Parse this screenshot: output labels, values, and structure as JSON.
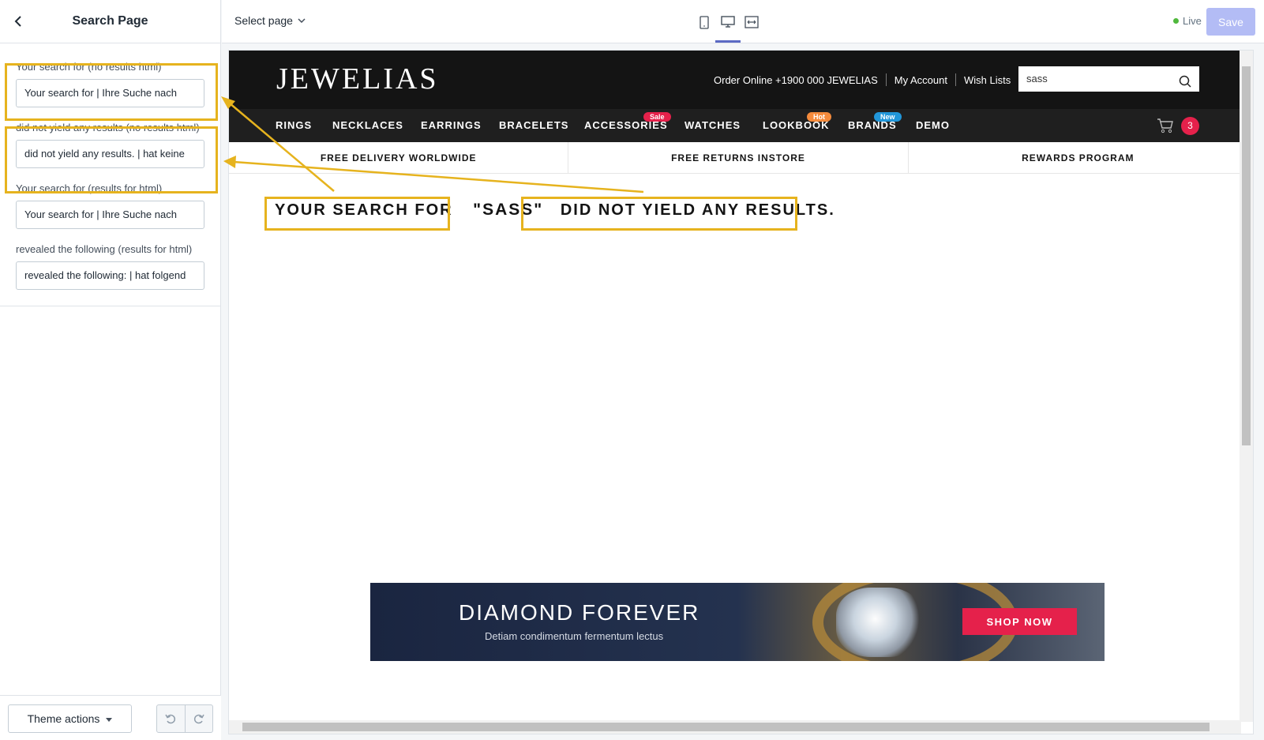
{
  "sidebar": {
    "title": "Search Page",
    "fields": [
      {
        "label": "Your search for (no results html)",
        "value": "Your search for | Ihre Suche nach"
      },
      {
        "label": "did not yield any results (no results html)",
        "value": "did not yield any results. | hat keine"
      },
      {
        "label": "Your search for (results for html)",
        "value": "Your search for | Ihre Suche nach"
      },
      {
        "label": "revealed the following (results for html)",
        "value": "revealed the following: | hat folgend"
      }
    ],
    "theme_actions": "Theme actions"
  },
  "topbar": {
    "select_page": "Select page",
    "live_label": "Live",
    "save_label": "Save"
  },
  "store": {
    "logo": "JEWELIAS",
    "order_online": "Order Online +1900 000 JEWELIAS",
    "my_account": "My Account",
    "wish_lists": "Wish Lists",
    "search_value": "sass",
    "nav": [
      {
        "label": "RINGS"
      },
      {
        "label": "NECKLACES"
      },
      {
        "label": "EARRINGS"
      },
      {
        "label": "BRACELETS"
      },
      {
        "label": "ACCESSORIES",
        "badge": "Sale",
        "badge_color": "#e5214b"
      },
      {
        "label": "WATCHES"
      },
      {
        "label": "LOOKBOOK",
        "badge": "Hot",
        "badge_color": "#f58b3c"
      },
      {
        "label": "BRANDS",
        "badge": "New",
        "badge_color": "#2196d9"
      },
      {
        "label": "DEMO"
      }
    ],
    "cart_count": "3",
    "strip": [
      "FREE DELIVERY WORLDWIDE",
      "FREE RETURNS INSTORE",
      "REWARDS PROGRAM"
    ],
    "result_prefix": "YOUR SEARCH FOR",
    "result_query": "\"SASS\"",
    "result_suffix": "DID NOT YIELD ANY RESULTS.",
    "banner_title": "DIAMOND FOREVER",
    "banner_sub": "Detiam condimentum fermentum lectus",
    "banner_button": "SHOP NOW"
  },
  "colors": {
    "annotation": "#e6b31e",
    "accent": "#e5214b",
    "primary": "#5c6ac4"
  }
}
